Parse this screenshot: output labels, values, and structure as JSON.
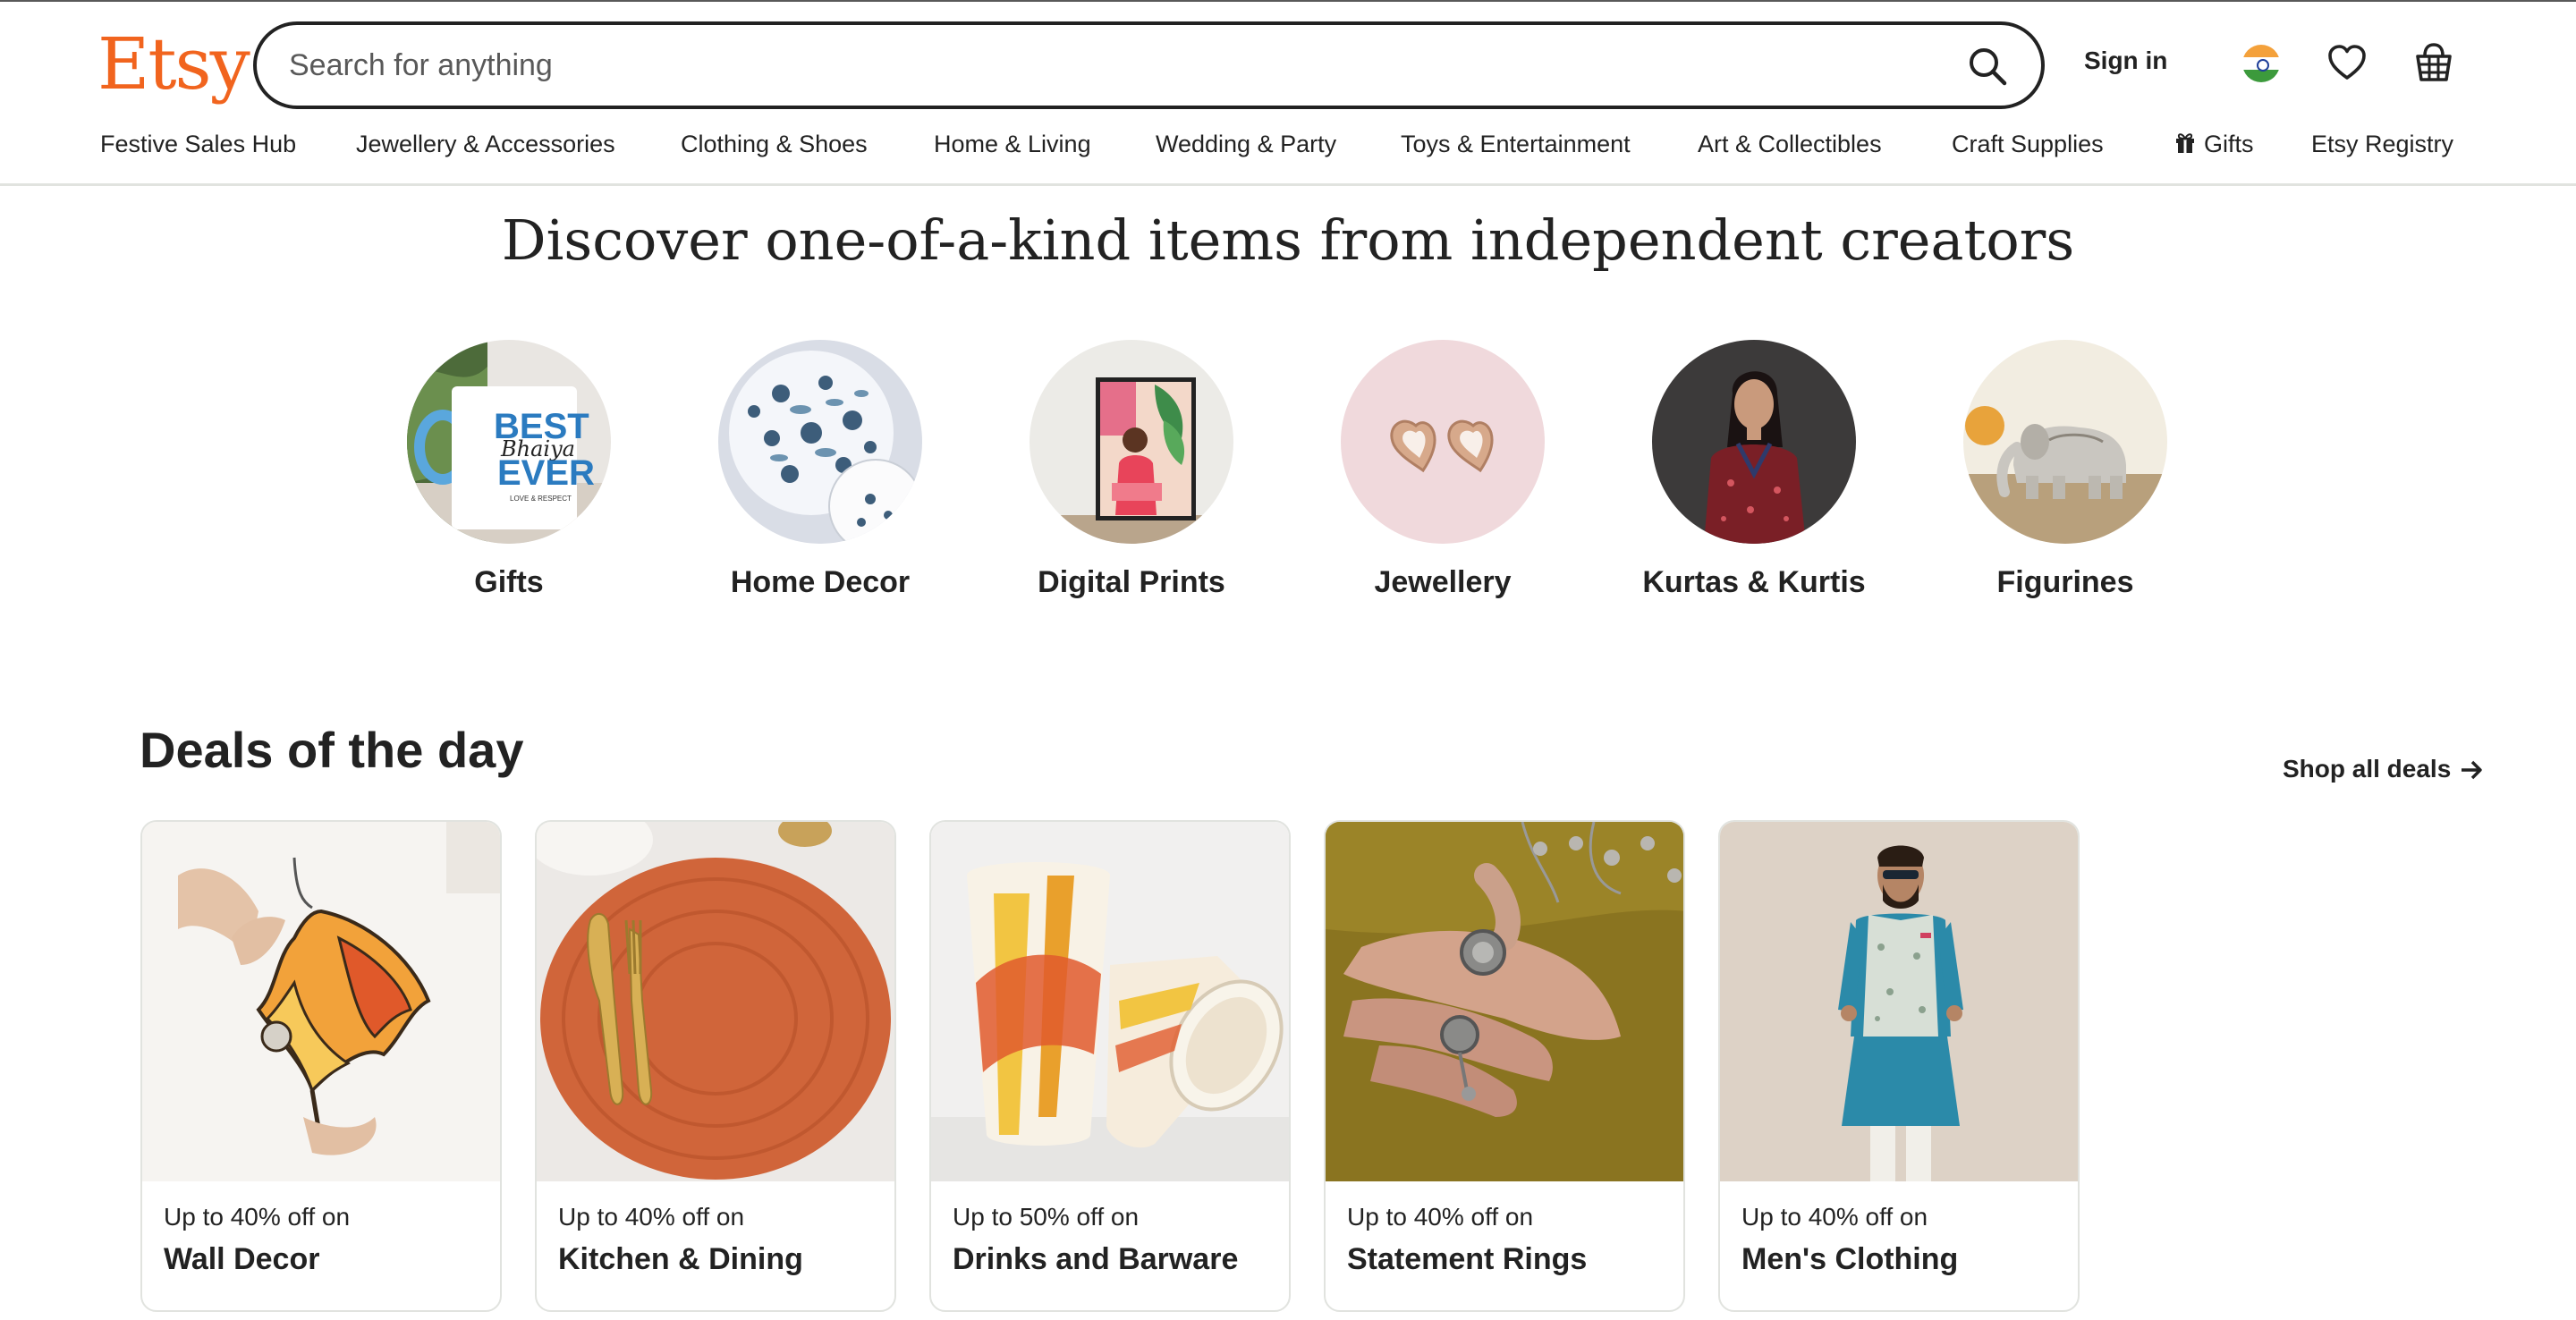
{
  "header": {
    "logo": "Etsy",
    "search_placeholder": "Search for anything",
    "sign_in": "Sign in"
  },
  "nav": [
    {
      "label": "Festive Sales Hub"
    },
    {
      "label": "Jewellery & Accessories"
    },
    {
      "label": "Clothing & Shoes"
    },
    {
      "label": "Home & Living"
    },
    {
      "label": "Wedding & Party"
    },
    {
      "label": "Toys & Entertainment"
    },
    {
      "label": "Art & Collectibles"
    },
    {
      "label": "Craft Supplies"
    },
    {
      "label": "Gifts",
      "icon": "gift-icon"
    },
    {
      "label": "Etsy Registry"
    }
  ],
  "hero": {
    "title": "Discover one-of-a-kind items from independent creators",
    "categories": [
      {
        "label": "Gifts"
      },
      {
        "label": "Home Decor"
      },
      {
        "label": "Digital Prints"
      },
      {
        "label": "Jewellery"
      },
      {
        "label": "Kurtas & Kurtis"
      },
      {
        "label": "Figurines"
      }
    ],
    "mug_text": [
      "BEST",
      "Bhaiya",
      "EVER",
      "LOVE & RESPECT"
    ]
  },
  "deals": {
    "title": "Deals of the day",
    "shop_all": "Shop all deals",
    "cards": [
      {
        "sub": "Up to 40% off on",
        "name": "Wall Decor"
      },
      {
        "sub": "Up to 40% off on",
        "name": "Kitchen & Dining"
      },
      {
        "sub": "Up to 50% off on",
        "name": "Drinks and Barware"
      },
      {
        "sub": "Up to 40% off on",
        "name": "Statement Rings"
      },
      {
        "sub": "Up to 40% off on",
        "name": "Men's Clothing"
      }
    ]
  },
  "colors": {
    "brand": "#f1641e",
    "text": "#222222",
    "border": "#e1e3df"
  }
}
